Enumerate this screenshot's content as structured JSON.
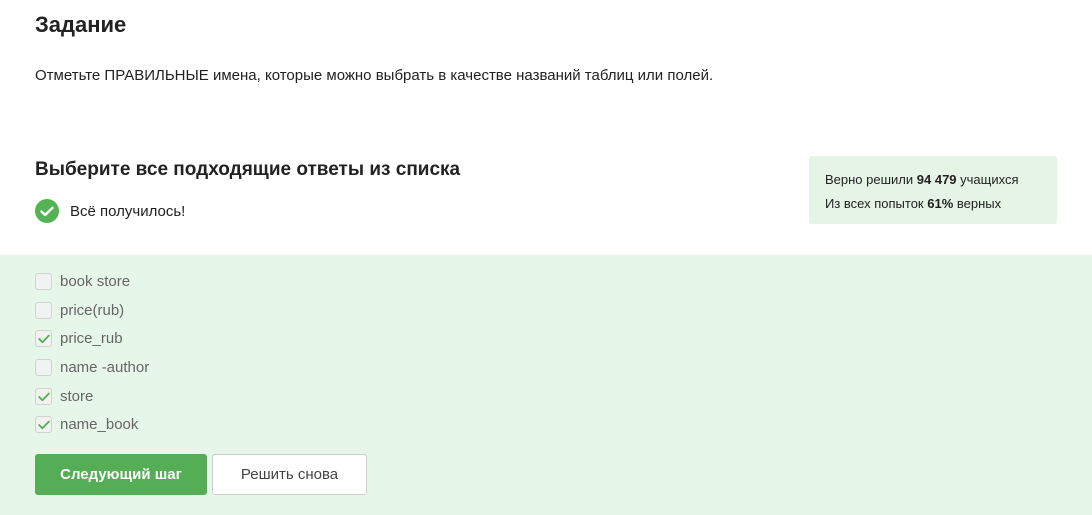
{
  "task": {
    "title": "Задание",
    "text": "Отметьте ПРАВИЛЬНЫЕ имена, которые можно выбрать в качестве названий таблиц или полей."
  },
  "question": {
    "title": "Выберите все подходящие ответы из списка",
    "status_text": "Всё получилось!"
  },
  "stats": {
    "solved_prefix": "Верно решили ",
    "solved_count": "94 479",
    "solved_suffix": " учащихся",
    "attempts_prefix": "Из всех попыток ",
    "attempts_percent": "61%",
    "attempts_suffix": " верных"
  },
  "options": [
    {
      "label": "book store",
      "checked": false
    },
    {
      "label": "price(rub)",
      "checked": false
    },
    {
      "label": "price_rub",
      "checked": true
    },
    {
      "label": "name -author",
      "checked": false
    },
    {
      "label": "store",
      "checked": true
    },
    {
      "label": "name_book",
      "checked": true
    }
  ],
  "buttons": {
    "next_label": "Следующий шаг",
    "retry_label": "Решить снова"
  },
  "colors": {
    "accent_green": "#55ad55",
    "panel_bg": "#e6f6e8",
    "stats_bg": "#e6f4e6"
  }
}
